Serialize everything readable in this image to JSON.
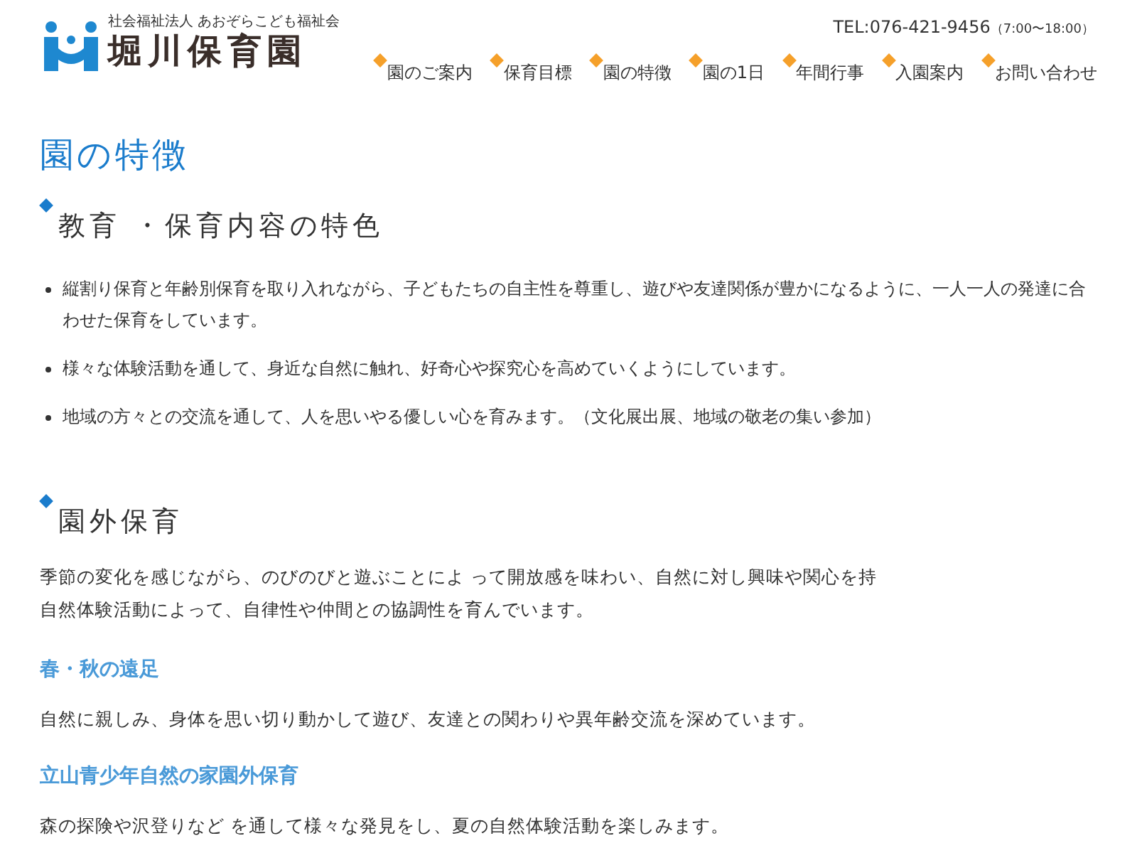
{
  "header": {
    "org": "社会福祉法人 あおぞらこども福祉会",
    "name": "堀川保育園",
    "tel": "TEL:076-421-9456",
    "hours": "（7:00〜18:00）"
  },
  "nav": [
    {
      "label": "園のご案内"
    },
    {
      "label": "保育目標"
    },
    {
      "label": "園の特徴"
    },
    {
      "label": "園の1日"
    },
    {
      "label": "年間行事"
    },
    {
      "label": "入園案内"
    },
    {
      "label": "お問い合わせ"
    }
  ],
  "page_title": "園の特徴",
  "sections": [
    {
      "heading": "教育 ・保育内容の特色",
      "bullets": [
        "縦割り保育と年齢別保育を取り入れながら、子どもたちの自主性を尊重し、遊びや友達関係が豊かになるように、一人一人の発達に合わせた保育をしています。",
        "様々な体験活動を通して、身近な自然に触れ、好奇心や探究心を高めていくようにしています。",
        "地域の方々との交流を通して、人を思いやる優しい心を育みます。（文化展出展、地域の敬老の集い参加）"
      ]
    },
    {
      "heading": "園外保育",
      "intro": [
        "季節の変化を感じながら、のびのびと遊ぶことによ って開放感を味わい、自然に対し興味や関心を持",
        "自然体験活動によって、自律性や仲間との協調性を育んでいます。"
      ],
      "subsections": [
        {
          "title": "春・秋の遠足",
          "text": "自然に親しみ、身体を思い切り動かして遊び、友達との関わりや異年齢交流を深めています。"
        },
        {
          "title": "立山青少年自然の家園外保育",
          "text": "森の探険や沢登りなど を通して様々な発見をし、夏の自然体験活動を楽しみます。"
        }
      ]
    }
  ]
}
